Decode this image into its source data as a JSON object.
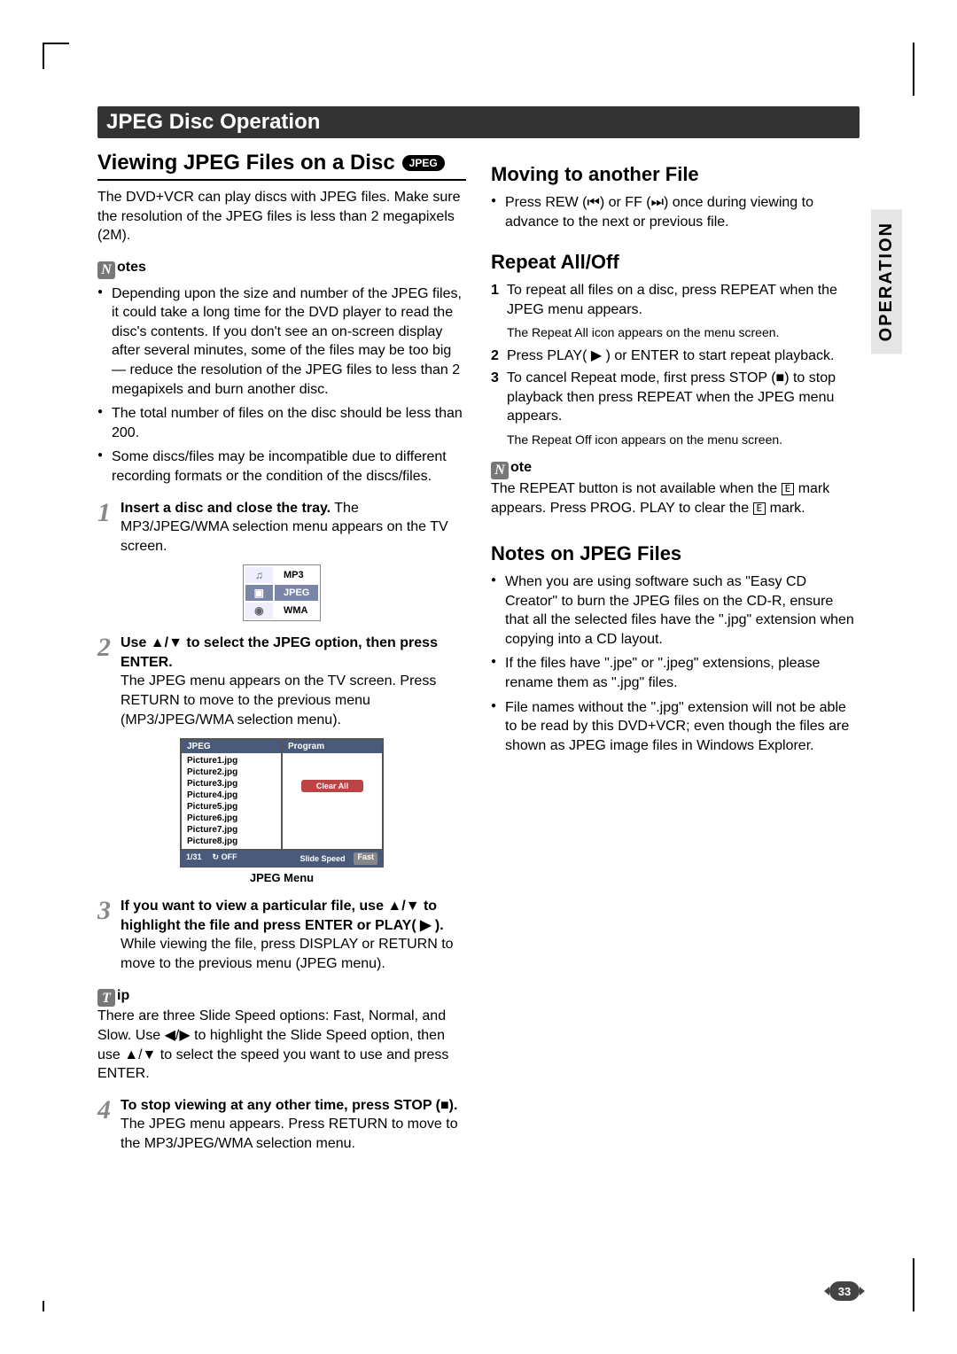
{
  "sideTab": "OPERATION",
  "pageNumber": "33",
  "sectionTitle": "JPEG Disc Operation",
  "left": {
    "heading": "Viewing JPEG Files on a Disc",
    "badge": "JPEG",
    "intro": "The DVD+VCR can play discs with JPEG files. Make sure the resolution of the JPEG files is less than 2 megapixels (2M).",
    "notesLabel": "otes",
    "notes": [
      "Depending upon the size and number of the JPEG files, it could take a long time for the DVD player to read the disc's contents. If you don't see an on-screen display after several minutes, some of the files may be too big — reduce the resolution of the JPEG files to less than 2 megapixels and burn another disc.",
      "The total number of files on the disc should be less than 200.",
      "Some discs/files may be incompatible due to different recording formats or the condition of the discs/files."
    ],
    "steps": [
      {
        "num": "1",
        "lead": "Insert a disc and close the tray.",
        "body": "The MP3/JPEG/WMA selection menu appears on the TV screen."
      },
      {
        "num": "2",
        "lead": "Use ▲/▼ to select the JPEG option, then press ENTER.",
        "body": "The JPEG menu appears on the TV screen. Press RETURN to move to the previous menu (MP3/JPEG/WMA selection menu)."
      },
      {
        "num": "3",
        "lead": "If you want to view a particular file, use ▲/▼ to highlight the file and press ENTER or PLAY( ▶ ).",
        "body": "While viewing the file, press DISPLAY or RETURN to move to the previous menu (JPEG menu)."
      },
      {
        "num": "4",
        "lead": "To stop viewing at any other time, press STOP (■).",
        "body": "The JPEG menu appears. Press RETURN to move to the MP3/JPEG/WMA selection menu."
      }
    ],
    "selMenu": {
      "items": [
        "MP3",
        "JPEG",
        "WMA"
      ],
      "selectedIndex": 1
    },
    "jpegMenu": {
      "titleLeft": "JPEG",
      "titleRight": "Program",
      "files": [
        "Picture1.jpg",
        "Picture2.jpg",
        "Picture3.jpg",
        "Picture4.jpg",
        "Picture5.jpg",
        "Picture6.jpg",
        "Picture7.jpg",
        "Picture8.jpg"
      ],
      "clearAll": "Clear All",
      "counter": "1/31",
      "repeatState": "OFF",
      "slideLabel": "Slide Speed",
      "slideValue": "Fast",
      "caption": "JPEG Menu"
    },
    "tipLabel": "ip",
    "tip": "There are three Slide Speed options: Fast, Normal, and Slow. Use ◀/▶ to highlight the Slide Speed option, then use ▲/▼ to select the speed you want to use and press ENTER."
  },
  "right": {
    "moving": {
      "title": "Moving to another File",
      "bullet": "Press REW (⏮) or FF (⏭) once during viewing to advance to the next or previous file."
    },
    "repeat": {
      "title": "Repeat All/Off",
      "items": [
        {
          "n": "1",
          "text": "To repeat all files on a disc, press REPEAT when the JPEG menu appears.",
          "sub": "The Repeat All icon appears on the menu screen."
        },
        {
          "n": "2",
          "text": "Press PLAY( ▶ ) or ENTER to start repeat playback."
        },
        {
          "n": "3",
          "text": "To cancel Repeat mode, first press STOP (■) to stop playback then press REPEAT when the JPEG menu appears.",
          "sub": "The Repeat Off icon appears on the menu screen."
        }
      ],
      "noteLabel": "ote",
      "noteBefore": "The REPEAT button is not available when the ",
      "noteMid": " mark appears. Press PROG. PLAY to clear the ",
      "noteAfter": " mark.",
      "emark": "E"
    },
    "notesJpeg": {
      "title": "Notes on JPEG Files",
      "bullets": [
        "When you are using software such as \"Easy CD Creator\" to burn the JPEG files on the CD-R, ensure that all the selected files have the \".jpg\" extension when copying into a CD layout.",
        "If the files have \".jpe\" or \".jpeg\" extensions, please rename them as \".jpg\" files.",
        "File names without the \".jpg\" extension will not be able to be read by this DVD+VCR; even though the files are shown as JPEG image files in Windows Explorer."
      ]
    }
  }
}
